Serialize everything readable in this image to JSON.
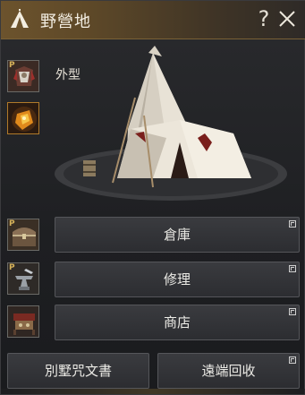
{
  "window": {
    "title": "野營地",
    "help_label": "?",
    "close_icon": "close-icon"
  },
  "appearance": {
    "label": "外型",
    "slots": [
      {
        "name": "costume-slot",
        "badge": "P",
        "icon": "armor-costume-icon"
      },
      {
        "name": "gem-slot",
        "badge": "",
        "icon": "amber-gem-icon"
      }
    ]
  },
  "preview": {
    "icon": "tent-preview-icon"
  },
  "actions": [
    {
      "label": "倉庫",
      "badge": "P",
      "icon": "treasure-chest-icon",
      "has_popout": true
    },
    {
      "label": "修理",
      "badge": "P",
      "icon": "anvil-icon",
      "has_popout": true
    },
    {
      "label": "商店",
      "badge": "",
      "icon": "merchant-stall-icon",
      "has_popout": true
    }
  ],
  "bottom_buttons": [
    {
      "label": "別墅咒文書",
      "has_popout": false
    },
    {
      "label": "遠端回收",
      "has_popout": true
    }
  ],
  "colors": {
    "title_bar": "#6c532d",
    "badge": "#d6b25a",
    "button_bg": "#33343a"
  }
}
